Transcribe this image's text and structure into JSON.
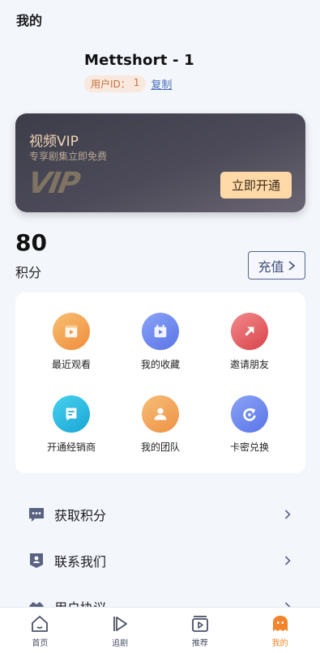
{
  "header": {
    "title": "我的"
  },
  "profile": {
    "name": "Mettshort - 1",
    "uid_label": "用户ID：",
    "uid_value": "1",
    "copy_label": "复制"
  },
  "vip": {
    "title": "视频VIP",
    "subtitle": "专享剧集立即免费",
    "logo": "VIP",
    "button": "立即开通"
  },
  "points": {
    "value": "80",
    "label": "积分",
    "recharge_label": "充值"
  },
  "grid": [
    {
      "label": "最近观看",
      "icon": "film-icon",
      "color": "#f5a252"
    },
    {
      "label": "我的收藏",
      "icon": "calendar-play-icon",
      "color": "#6f86f0"
    },
    {
      "label": "邀请朋友",
      "icon": "arrow-up-right-icon",
      "color": "#e85a5e"
    },
    {
      "label": "开通经销商",
      "icon": "bookmark-flag-icon",
      "color": "#24b9e0"
    },
    {
      "label": "我的团队",
      "icon": "person-icon",
      "color": "#f3a250"
    },
    {
      "label": "卡密兑换",
      "icon": "redo-icon",
      "color": "#6d85ef"
    }
  ],
  "menu": [
    {
      "label": "获取积分",
      "icon": "chat-dots-icon"
    },
    {
      "label": "联系我们",
      "icon": "shield-contact-icon"
    },
    {
      "label": "用户协议",
      "icon": "handshake-icon"
    }
  ],
  "tabbar": [
    {
      "label": "首页",
      "icon": "home-icon",
      "active": false
    },
    {
      "label": "追剧",
      "icon": "play-icon",
      "active": false
    },
    {
      "label": "推荐",
      "icon": "tv-play-icon",
      "active": false
    },
    {
      "label": "我的",
      "icon": "ghost-icon",
      "active": true
    }
  ],
  "colors": {
    "accent": "#f0852d",
    "vip_gold": "#ffd9a8",
    "icon_gray": "#5a6282"
  }
}
